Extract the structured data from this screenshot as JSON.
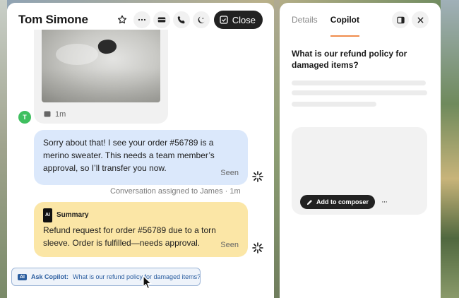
{
  "conversation": {
    "title": "Tom Simone",
    "close_label": "Close",
    "image_time": "1m",
    "avatar_initial": "T",
    "agent_message": "Sorry about that! I see your order #56789 is a merino sweater. This needs a team member’s approval, so I’ll transfer you now.",
    "agent_seen": "Seen",
    "assigned_note": "Conversation assigned to James  ·  1m",
    "summary": {
      "badge": "AI",
      "title": "Summary",
      "text": "Refund request for order #56789 due to a torn sleeve. Order is fulfilled—needs approval.",
      "seen": "Seen"
    },
    "ask_copilot": {
      "badge": "AI",
      "prefix": "Ask Copilot:",
      "question": "What is our refund policy for damaged items?"
    }
  },
  "copilot": {
    "tabs": [
      {
        "label": "Details",
        "active": false
      },
      {
        "label": "Copilot",
        "active": true
      }
    ],
    "question": "What is our refund policy for damaged items?",
    "add_to_composer_label": "Add to composer",
    "more_label": "···"
  },
  "colors": {
    "agent_bubble": "#dbe8fb",
    "summary_bubble": "#fbe6a6",
    "avatar": "#3fbf5f",
    "active_tab_underline": "#f08c4c",
    "ask_bar_text": "#2a5d9f"
  }
}
